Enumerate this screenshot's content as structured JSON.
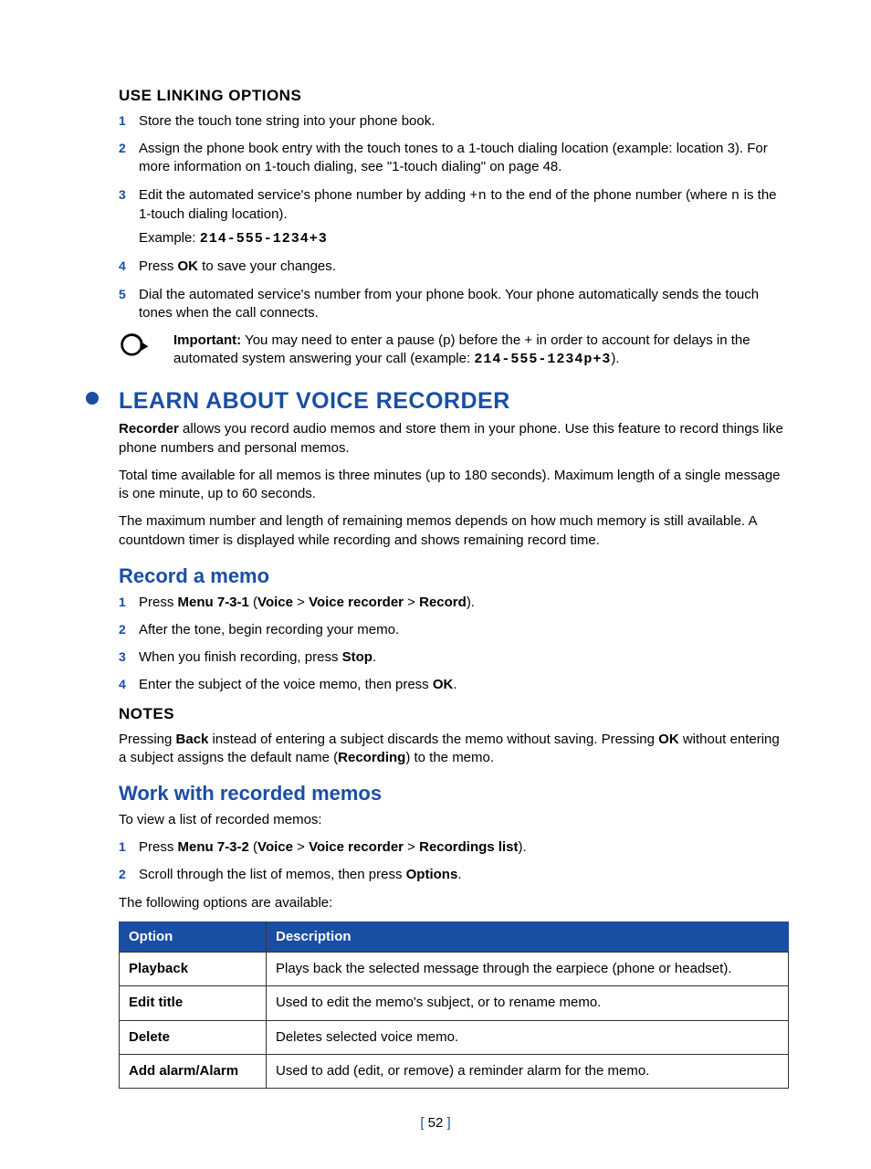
{
  "sec1": {
    "heading": "USE LINKING OPTIONS",
    "items": [
      {
        "num": "1",
        "text": "Store the touch tone string into your phone book."
      },
      {
        "num": "2",
        "text": "Assign the phone book entry with the touch tones to a 1-touch dialing location (example: location 3). For more information on 1-touch dialing, see \"1-touch dialing\" on page 48."
      },
      {
        "num": "3",
        "pre": "Edit the automated service's phone number by adding ",
        "code1": "+n",
        "mid": " to the end of the phone number (where ",
        "code2": "n",
        "post": " is the 1-touch dialing location).",
        "example_label": "Example: ",
        "example_code": "214-555-1234+3"
      },
      {
        "num": "4",
        "pre": "Press ",
        "bold": "OK",
        "post": " to save your changes."
      },
      {
        "num": "5",
        "text": "Dial the automated service's number from your phone book. Your phone automatically sends the touch tones when the call connects."
      }
    ],
    "important": {
      "label": "Important:",
      "pre": " You may need to enter a pause (p) before the + in order to account for delays in the automated system answering your call (example: ",
      "code": "214-555-1234p+3",
      "post": ")."
    }
  },
  "sec2": {
    "heading": "LEARN ABOUT VOICE RECORDER",
    "p1_bold": "Recorder",
    "p1_rest": " allows you record audio memos and store them in your phone. Use this feature to record things like phone numbers and personal memos.",
    "p2": "Total time available for all memos is three minutes (up to 180 seconds). Maximum length of a single message is one minute, up to 60 seconds.",
    "p3": "The maximum number and length of remaining memos depends on how much memory is still available. A countdown timer is displayed while recording and shows remaining record time."
  },
  "sec3": {
    "heading": "Record a memo",
    "items": [
      {
        "num": "1",
        "parts": [
          "Press ",
          "Menu 7-3-1",
          " (",
          "Voice",
          " > ",
          "Voice recorder",
          " > ",
          "Record",
          ")."
        ]
      },
      {
        "num": "2",
        "text": "After the tone, begin recording your memo."
      },
      {
        "num": "3",
        "parts": [
          "When you finish recording, press ",
          "Stop",
          "."
        ]
      },
      {
        "num": "4",
        "parts": [
          "Enter the subject of the voice memo, then press ",
          "OK",
          "."
        ]
      }
    ]
  },
  "notes": {
    "heading": "NOTES",
    "p": [
      "Pressing ",
      "Back",
      " instead of entering a subject discards the memo without saving. Pressing ",
      "OK",
      " without entering a subject assigns the default name (",
      "Recording",
      ") to the memo."
    ]
  },
  "sec4": {
    "heading": "Work with recorded memos",
    "intro": "To view a list of recorded memos:",
    "items": [
      {
        "num": "1",
        "parts": [
          "Press ",
          "Menu 7-3-2",
          " (",
          "Voice",
          " > ",
          "Voice recorder",
          " > ",
          "Recordings list",
          ")."
        ]
      },
      {
        "num": "2",
        "parts": [
          "Scroll through the list of memos, then press ",
          "Options",
          "."
        ]
      }
    ],
    "outro": "The following options are available:"
  },
  "table": {
    "head_option": "Option",
    "head_desc": "Description",
    "rows": [
      {
        "option": "Playback",
        "desc": "Plays back the selected message through the earpiece (phone or headset)."
      },
      {
        "option": "Edit title",
        "desc": "Used to edit the memo's subject, or to rename memo."
      },
      {
        "option": "Delete",
        "desc": "Deletes selected voice memo."
      },
      {
        "option": "Add alarm/Alarm",
        "desc": "Used to add (edit, or remove) a reminder alarm for the memo."
      }
    ]
  },
  "page": {
    "num": "52"
  }
}
